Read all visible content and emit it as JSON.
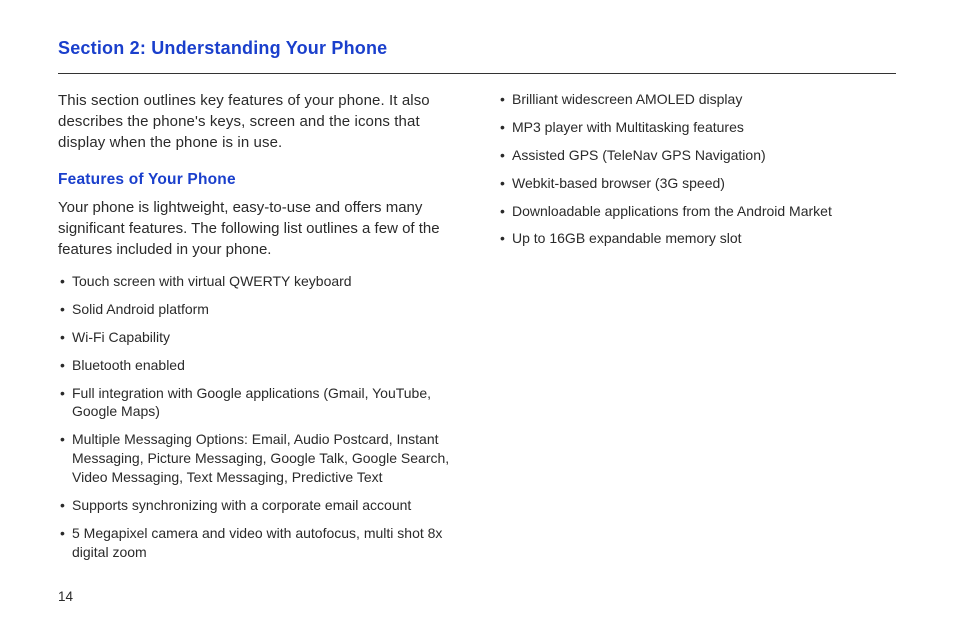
{
  "section": {
    "title": "Section 2: Understanding Your Phone",
    "intro": "This section outlines key features of your phone. It also describes the phone's keys, screen and the icons that display when the phone is in use.",
    "sub_heading": "Features of Your Phone",
    "sub_text": "Your phone is lightweight, easy-to-use and offers many significant features. The following list outlines a few of the features included in your phone.",
    "features_col1": [
      "Touch screen with virtual QWERTY keyboard",
      "Solid Android platform",
      "Wi-Fi Capability",
      "Bluetooth enabled",
      "Full integration with Google applications (Gmail, YouTube, Google Maps)",
      "Multiple Messaging Options: Email, Audio Postcard, Instant Messaging, Picture Messaging, Google Talk, Google Search, Video Messaging, Text Messaging, Predictive Text",
      "Supports synchronizing with a corporate email account",
      "5 Megapixel camera and video with autofocus, multi shot 8x digital zoom"
    ],
    "features_col2": [
      "Brilliant widescreen AMOLED display",
      "MP3 player with Multitasking features",
      "Assisted GPS (TeleNav GPS Navigation)",
      "Webkit-based browser (3G speed)",
      "Downloadable applications from the Android Market",
      "Up to 16GB expandable memory slot"
    ]
  },
  "page_number": "14"
}
